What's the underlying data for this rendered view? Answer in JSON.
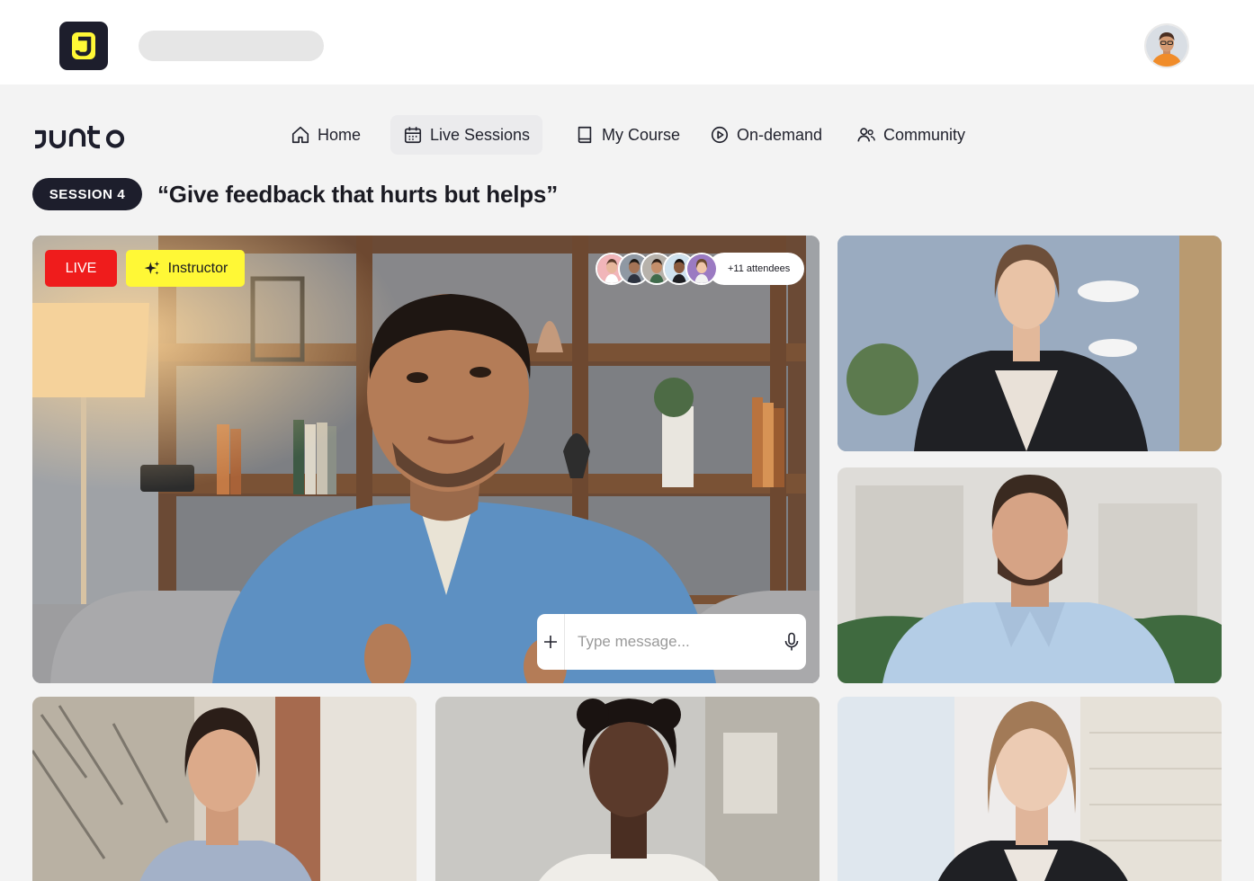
{
  "header": {
    "logo_letter": "J",
    "avatar_icon": "user-avatar"
  },
  "brand": {
    "name": "junto"
  },
  "nav": {
    "items": [
      {
        "label": "Home",
        "icon": "home-icon",
        "active": false
      },
      {
        "label": "Live Sessions",
        "icon": "calendar-icon",
        "active": true
      },
      {
        "label": "My Course",
        "icon": "book-icon",
        "active": false
      },
      {
        "label": "On-demand",
        "icon": "play-circle-icon",
        "active": false
      },
      {
        "label": "Community",
        "icon": "users-icon",
        "active": false
      }
    ]
  },
  "session": {
    "badge": "SESSION 4",
    "title": "“Give feedback that hurts but helps”"
  },
  "main_video": {
    "live_label": "LIVE",
    "instructor_label": "Instructor",
    "attendees_label": "+11 attendees",
    "chat": {
      "placeholder": "Type message..."
    }
  },
  "colors": {
    "accent_yellow": "#fff836",
    "live_red": "#ef1c1c",
    "dark": "#1d1e2c",
    "page_bg": "#f3f3f3"
  }
}
